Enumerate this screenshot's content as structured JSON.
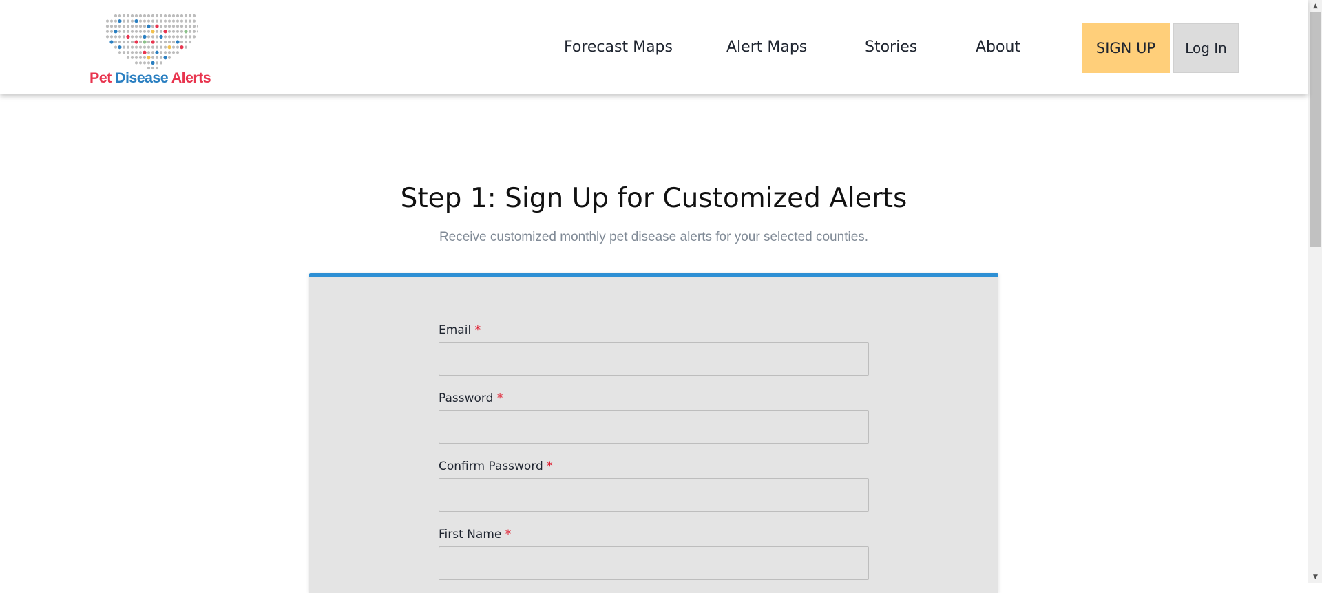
{
  "colors": {
    "brand_red": "#e8344e",
    "brand_blue": "#2a7fc1",
    "signup_bg": "#ffcf7a",
    "login_bg": "#dcdcdc",
    "card_accent": "#2d8fd4",
    "required_mark": "#e0192b"
  },
  "header": {
    "logo": {
      "word1": "Pet",
      "word2": "Disease",
      "word3": "Alerts",
      "icon": "usa-dot-map-logo"
    },
    "nav": [
      {
        "label": "Forecast Maps"
      },
      {
        "label": "Alert Maps"
      },
      {
        "label": "Stories"
      },
      {
        "label": "About"
      }
    ],
    "signup_label": "SIGN UP",
    "login_label": "Log In"
  },
  "main": {
    "title": "Step 1: Sign Up for Customized Alerts",
    "subtitle": "Receive customized monthly pet disease alerts for your selected counties."
  },
  "form": {
    "required_marker": "*",
    "fields": [
      {
        "label": "Email",
        "value": ""
      },
      {
        "label": "Password",
        "value": ""
      },
      {
        "label": "Confirm Password",
        "value": ""
      },
      {
        "label": "First Name",
        "value": ""
      }
    ]
  },
  "scrollbar": {
    "up_icon": "scroll-up-arrow-icon",
    "down_icon": "scroll-down-arrow-icon"
  }
}
